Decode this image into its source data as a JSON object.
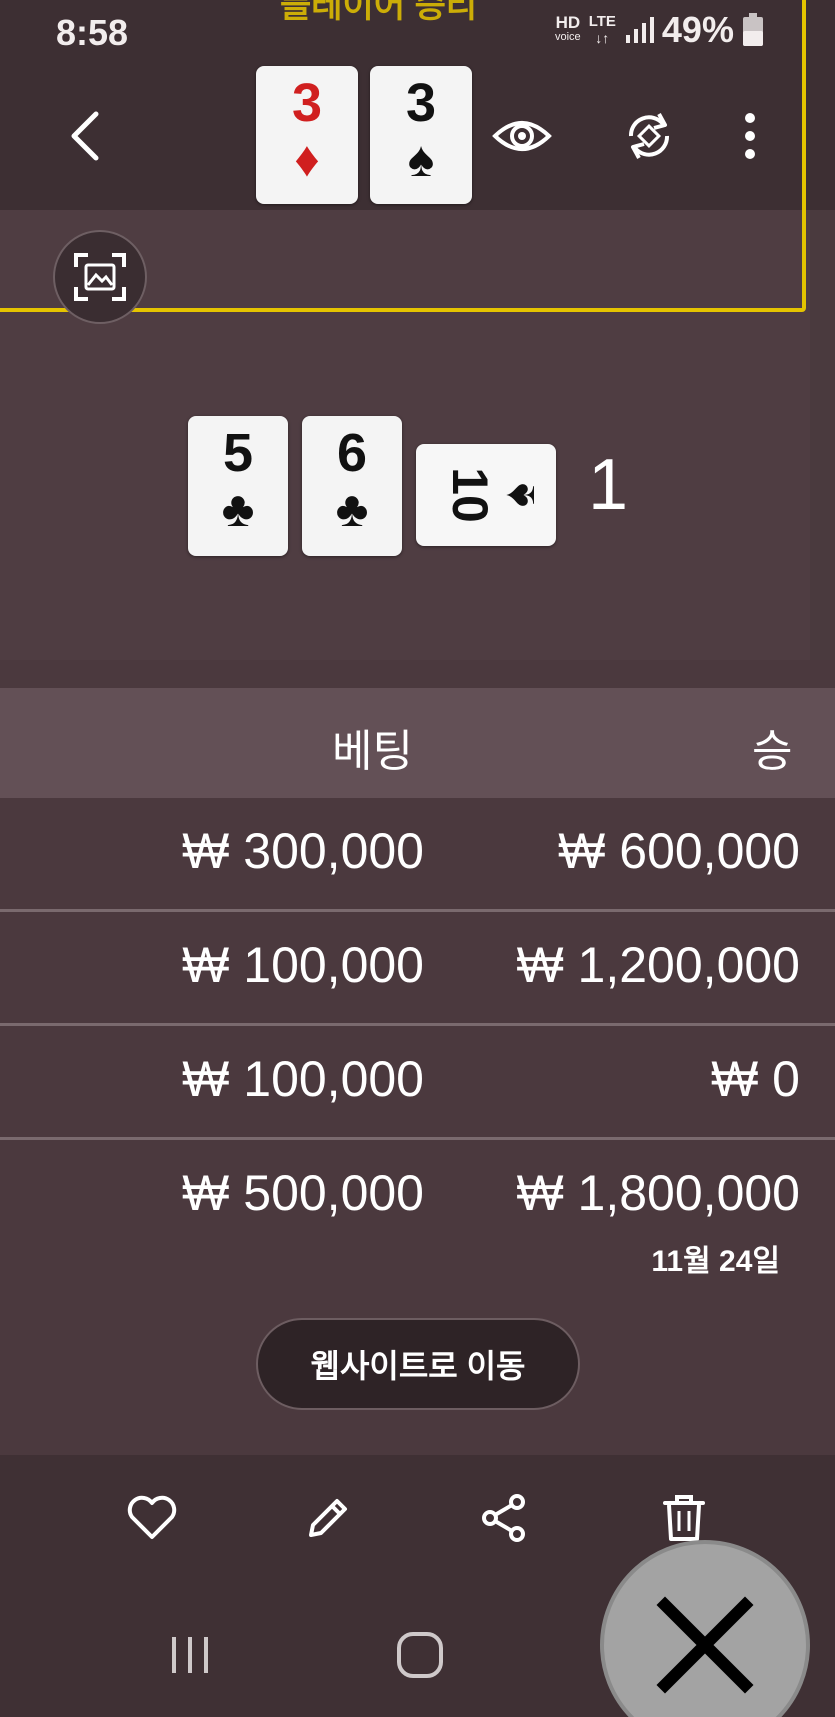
{
  "status_bar": {
    "time": "8:58",
    "hd_label": "HD",
    "voice_label": "voice",
    "lte_label": "LTE",
    "battery": "49%"
  },
  "overlay": {
    "title": "플레이어 승리"
  },
  "header": {
    "back_icon": "chevron-left-icon",
    "cards": [
      {
        "rank": "3",
        "suit": "♦",
        "color": "#d01f1f"
      },
      {
        "rank": "3",
        "suit": "♠",
        "color": "#111111"
      }
    ],
    "eye_icon": "eye-icon",
    "rotate_icon": "rotate-icon",
    "more_icon": "more-vertical-icon"
  },
  "scan_icon": "image-scan-icon",
  "hand": {
    "cards": [
      {
        "rank": "5",
        "suit": "♣"
      },
      {
        "rank": "6",
        "suit": "♣"
      },
      {
        "rank": "10",
        "suit": "♠",
        "orientation": "sideways"
      }
    ],
    "count": "1"
  },
  "table": {
    "headers": {
      "bet": "베팅",
      "win": "승"
    },
    "rows": [
      {
        "bet": "₩ 300,000",
        "win": "₩ 600,000"
      },
      {
        "bet": "₩ 100,000",
        "win": "₩ 1,200,000"
      },
      {
        "bet": "₩ 100,000",
        "win": "₩ 0"
      },
      {
        "bet": "₩ 500,000",
        "win": "₩ 1,800,000"
      }
    ]
  },
  "date": "11월 24일",
  "website_button": "웹사이트로 이동",
  "actions": [
    {
      "icon": "heart-icon"
    },
    {
      "icon": "pencil-icon"
    },
    {
      "icon": "share-icon"
    },
    {
      "icon": "trash-icon"
    }
  ],
  "nav": {
    "recents_icon": "recents-icon",
    "home_icon": "home-icon",
    "back_icon": "back-icon",
    "close_icon": "close-icon"
  },
  "colors": {
    "background": "#4a3a3e",
    "accent_yellow": "#e5c400",
    "red_suit": "#d01f1f"
  }
}
